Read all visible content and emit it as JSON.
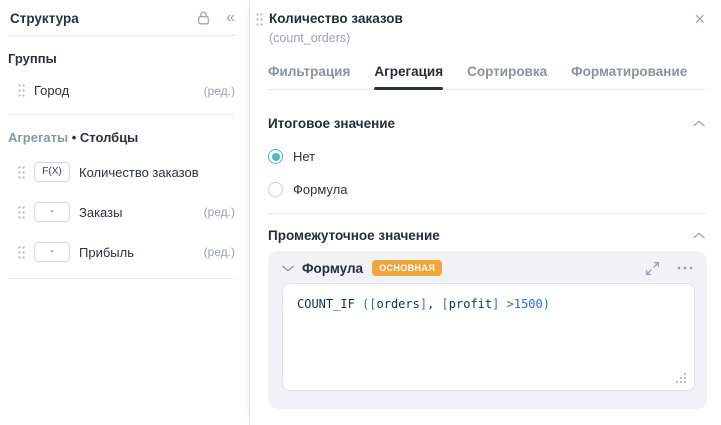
{
  "sidebar": {
    "title": "Структура",
    "collapse_glyph": "«",
    "groups": {
      "title": "Группы",
      "items": [
        {
          "label": "Город",
          "edit": "(ред.)"
        }
      ]
    },
    "aggregates": {
      "title_muted": "Агрегаты",
      "title_sep": " • ",
      "title_main": "Столбцы",
      "items": [
        {
          "badge": "F(X)",
          "label": "Количество заказов",
          "edit": ""
        },
        {
          "badge": "-",
          "label": "Заказы",
          "edit": "(ред.)"
        },
        {
          "badge": "-",
          "label": "Прибыль",
          "edit": "(ред.)"
        }
      ]
    }
  },
  "panel": {
    "title": "Количество заказов",
    "subtitle": "(count_orders)",
    "close_glyph": "×",
    "tabs": [
      {
        "label": "Фильтрация"
      },
      {
        "label": "Агрегация"
      },
      {
        "label": "Сортировка"
      },
      {
        "label": "Форматирование"
      }
    ],
    "active_tab": "Агрегация",
    "total_value": {
      "title": "Итоговое значение",
      "options": [
        {
          "label": "Нет",
          "selected": true
        },
        {
          "label": "Формула",
          "selected": false
        }
      ]
    },
    "intermediate_value": {
      "title": "Промежуточное значение",
      "formula_card": {
        "title": "Формула",
        "badge": "ОСНОВНАЯ",
        "code": "COUNT_IF ([orders], [profit] >1500)",
        "code_tokens": [
          {
            "t": "COUNT_IF ",
            "c": "fn"
          },
          {
            "t": "(",
            "c": "paren"
          },
          {
            "t": "[",
            "c": "bracket"
          },
          {
            "t": "orders",
            "c": "field"
          },
          {
            "t": "]",
            "c": "bracket"
          },
          {
            "t": ", ",
            "c": "plain"
          },
          {
            "t": "[",
            "c": "bracket"
          },
          {
            "t": "profit",
            "c": "field"
          },
          {
            "t": "]",
            "c": "bracket"
          },
          {
            "t": " ",
            "c": "plain"
          },
          {
            "t": ">",
            "c": "op"
          },
          {
            "t": "1500",
            "c": "num"
          },
          {
            "t": ")",
            "c": "paren"
          }
        ]
      }
    }
  },
  "colors": {
    "accent_teal": "#4DB8BE",
    "badge_orange": "#F0A63C",
    "tab_active_text": "#252D38",
    "muted_text": "#98A1B0",
    "divider": "#E8EBEF",
    "card_background": "#F0F2F5"
  }
}
